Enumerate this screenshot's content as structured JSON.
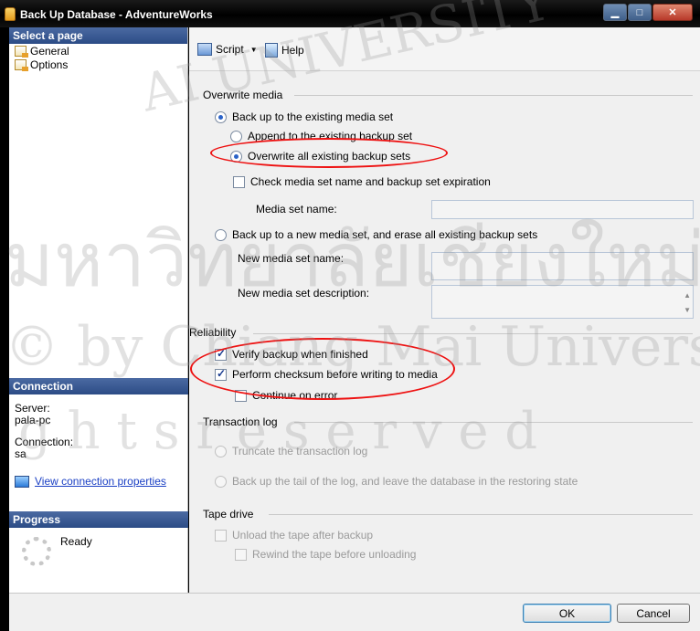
{
  "window": {
    "title": "Back Up Database - AdventureWorks"
  },
  "sidebar": {
    "select_page_header": "Select a page",
    "pages": [
      {
        "label": "General"
      },
      {
        "label": "Options"
      }
    ],
    "connection_header": "Connection",
    "server_label": "Server:",
    "server_value": "pala-pc",
    "connection_label": "Connection:",
    "connection_value": "sa",
    "view_connection_link": "View connection properties",
    "progress_header": "Progress",
    "progress_status": "Ready"
  },
  "toolbar": {
    "script_label": "Script",
    "help_label": "Help"
  },
  "overwrite_media": {
    "section_title": "Overwrite media",
    "backup_existing": "Back up to the existing media set",
    "append": "Append to the existing backup set",
    "overwrite_all": "Overwrite all existing backup sets",
    "check_media": "Check media set name and backup set expiration",
    "media_set_name_label": "Media set name:",
    "backup_new": "Back up to a new media set, and erase all existing backup sets",
    "new_media_set_name_label": "New media set name:",
    "new_media_set_description_label": "New media set description:"
  },
  "reliability": {
    "section_title": "Reliability",
    "verify": "Verify backup when finished",
    "checksum": "Perform checksum before writing to media",
    "continue_on_error": "Continue on error"
  },
  "transaction_log": {
    "section_title": "Transaction log",
    "truncate": "Truncate the transaction log",
    "backup_tail": "Back up the tail of the log, and leave the database in the restoring state"
  },
  "tape_drive": {
    "section_title": "Tape drive",
    "unload": "Unload the tape after backup",
    "rewind": "Rewind the tape before unloading"
  },
  "buttons": {
    "ok": "OK",
    "cancel": "Cancel"
  },
  "watermark": {
    "line1": "AI UNIVERSITY",
    "line2": "มหาวิทยาลัยเชียงใหม่",
    "line3": "© by Chiang Mai University",
    "line4": "g h t s   r e s e r v e d"
  },
  "state": {
    "backup_existing_selected": true,
    "overwrite_all_selected": true,
    "verify_checked": true,
    "checksum_checked": true,
    "continue_on_error_checked": false
  }
}
